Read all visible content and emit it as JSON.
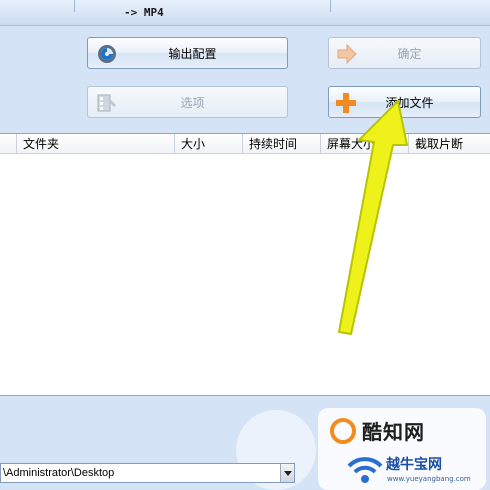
{
  "window": {
    "title": "-> MP4"
  },
  "buttons": {
    "output_config": "输出配置",
    "confirm": "确定",
    "options": "选项",
    "add_file": "添加文件"
  },
  "table": {
    "columns": [
      "文件夹",
      "大小",
      "持续时间",
      "屏幕大小",
      "截取片断"
    ],
    "rows": []
  },
  "output_path": {
    "value": "\\Administrator\\Desktop"
  },
  "watermark": {
    "brand1": "酷知网",
    "brand2": "越牛宝网",
    "url": "www.yueyangbang.com"
  },
  "colors": {
    "arrow": "#e9f31c",
    "background": "#d4e3f5"
  }
}
